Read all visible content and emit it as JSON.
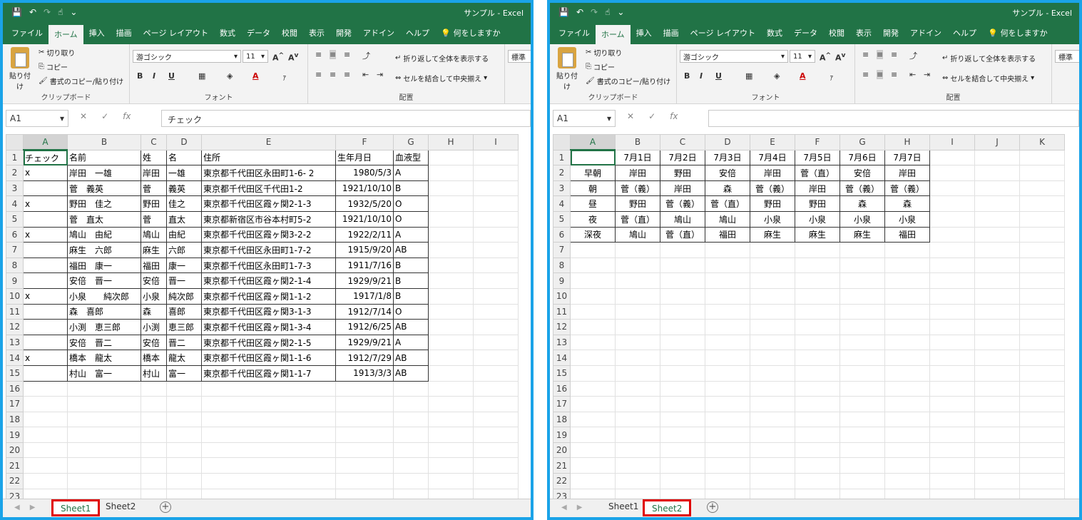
{
  "app": {
    "doc_name": "サンプル",
    "app_name": "Excel",
    "separator": "-"
  },
  "qat": {
    "save_icon": "save-icon",
    "undo": "↶",
    "redo": "↷",
    "touch": "☝",
    "more": "⌄"
  },
  "tabs": [
    "ファイル",
    "ホーム",
    "挿入",
    "描画",
    "ページ レイアウト",
    "数式",
    "データ",
    "校閲",
    "表示",
    "開発",
    "アドイン",
    "ヘルプ"
  ],
  "tell_me": "何をしますか",
  "ribbon": {
    "paste": "貼り付け",
    "cut": "切り取り",
    "copy": "コピー",
    "format_painter": "書式のコピー/貼り付け",
    "clipboard_label": "クリップボード",
    "font_name": "游ゴシック",
    "font_size": "11",
    "font_label": "フォント",
    "wrap_text": "折り返して全体を表示する",
    "merge_center": "セルを結合して中央揃え",
    "alignment_label": "配置",
    "number_format": "標準"
  },
  "sheet1": {
    "namebox": "A1",
    "formula": "チェック",
    "columns": [
      "A",
      "B",
      "C",
      "D",
      "E",
      "F",
      "G",
      "H",
      "I"
    ],
    "header": [
      "チェック",
      "名前",
      "姓",
      "名",
      "住所",
      "生年月日",
      "血液型"
    ],
    "rows": [
      [
        "x",
        "岸田　一雄",
        "岸田",
        "一雄",
        "東京都千代田区永田町1-6- 2",
        "1980/5/3",
        "A"
      ],
      [
        "",
        "菅　義英",
        "菅",
        "義英",
        "東京都千代田区千代田1-2",
        "1921/10/10",
        "B"
      ],
      [
        "x",
        "野田　佳之",
        "野田",
        "佳之",
        "東京都千代田区霞ヶ関2-1-3",
        "1932/5/20",
        "O"
      ],
      [
        "",
        "菅　直太",
        "菅",
        "直太",
        "東京都新宿区市谷本村町5-2",
        "1921/10/10",
        "O"
      ],
      [
        "x",
        "鳩山　由紀",
        "鳩山",
        "由紀",
        "東京都千代田区霞ヶ関3-2-2",
        "1922/2/11",
        "A"
      ],
      [
        "",
        "麻生　六郎",
        "麻生",
        "六郎",
        "東京都千代田区永田町1-7-2",
        "1915/9/20",
        "AB"
      ],
      [
        "",
        "福田　康一",
        "福田",
        "康一",
        "東京都千代田区永田町1-7-3",
        "1911/7/16",
        "B"
      ],
      [
        "",
        "安倍　晋一",
        "安倍",
        "晋一",
        "東京都千代田区霞ヶ関2-1-4",
        "1929/9/21",
        "B"
      ],
      [
        "x",
        "小泉　　純次郎",
        "小泉",
        "純次郎",
        "東京都千代田区霞ヶ関1-1-2",
        "1917/1/8",
        "B"
      ],
      [
        "",
        "森　喜郎",
        "森",
        "喜郎",
        "東京都千代田区霞ヶ関3-1-3",
        "1912/7/14",
        "O"
      ],
      [
        "",
        "小渕　恵三郎",
        "小渕",
        "恵三郎",
        "東京都千代田区霞ヶ関1-3-4",
        "1912/6/25",
        "AB"
      ],
      [
        "",
        "安倍　晋二",
        "安倍",
        "晋二",
        "東京都千代田区霞ヶ関2-1-5",
        "1929/9/21",
        "A"
      ],
      [
        "x",
        "橋本　龍太",
        "橋本",
        "龍太",
        "東京都千代田区霞ヶ関1-1-6",
        "1912/7/29",
        "AB"
      ],
      [
        "",
        "村山　富一",
        "村山",
        "富一",
        "東京都千代田区霞ヶ関1-1-7",
        "1913/3/3",
        "AB"
      ]
    ],
    "row_numbers": [
      "1",
      "2",
      "3",
      "4",
      "5",
      "6",
      "7",
      "8",
      "9",
      "10",
      "11",
      "12",
      "13",
      "14",
      "15",
      "16",
      "17",
      "18",
      "19",
      "20",
      "21",
      "22",
      "23"
    ]
  },
  "sheet2": {
    "namebox": "A1",
    "formula": "",
    "columns": [
      "A",
      "B",
      "C",
      "D",
      "E",
      "F",
      "G",
      "H",
      "I",
      "J",
      "K"
    ],
    "header": [
      "",
      "7月1日",
      "7月2日",
      "7月3日",
      "7月4日",
      "7月5日",
      "7月6日",
      "7月7日"
    ],
    "rows": [
      [
        "早朝",
        "岸田",
        "野田",
        "安倍",
        "岸田",
        "菅（直）",
        "安倍",
        "岸田"
      ],
      [
        "朝",
        "菅（義）",
        "岸田",
        "森",
        "菅（義）",
        "岸田",
        "菅（義）",
        "菅（義）"
      ],
      [
        "昼",
        "野田",
        "菅（義）",
        "菅（直）",
        "野田",
        "野田",
        "森",
        "森"
      ],
      [
        "夜",
        "菅（直）",
        "鳩山",
        "鳩山",
        "小泉",
        "小泉",
        "小泉",
        "小泉"
      ],
      [
        "深夜",
        "鳩山",
        "菅（直）",
        "福田",
        "麻生",
        "麻生",
        "麻生",
        "福田"
      ]
    ],
    "row_numbers": [
      "1",
      "2",
      "3",
      "4",
      "5",
      "6",
      "7",
      "8",
      "9",
      "10",
      "11",
      "12",
      "13",
      "14",
      "15",
      "16",
      "17",
      "18",
      "19",
      "20",
      "21",
      "22",
      "23"
    ]
  },
  "sheet_tabs": [
    "Sheet1",
    "Sheet2"
  ],
  "add_sheet": "+",
  "colors": {
    "excel_green": "#217346",
    "window_border": "#1aa3e8",
    "highlight_red": "#e00000"
  }
}
